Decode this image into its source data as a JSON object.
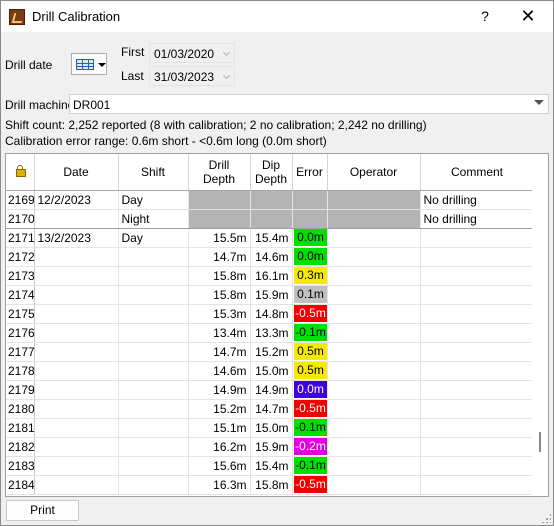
{
  "window": {
    "title": "Drill Calibration",
    "help": "?",
    "close": "✕"
  },
  "filters": {
    "drill_date_label": "Drill date",
    "first_label": "First",
    "first_value": "01/03/2020",
    "last_label": "Last",
    "last_value": "31/03/2023",
    "drill_machine_label": "Drill machine",
    "drill_machine_value": "DR001"
  },
  "summary": {
    "shift_count": "Shift count: 2,252 reported (8 with calibration; 2 no calibration; 2,242 no drilling)",
    "error_range": "Calibration error range: 0.6m short - <0.6m long (0.0m short)"
  },
  "table": {
    "columns": [
      "Date",
      "Shift",
      "Drill Depth",
      "Dip Depth",
      "Error",
      "Operator",
      "Comment"
    ],
    "header_drill_depth": [
      "Drill",
      "Depth"
    ],
    "header_dip_depth": [
      "Dip",
      "Depth"
    ],
    "rows": [
      {
        "idx": "2169",
        "date": "12/2/2023",
        "shift": "Day",
        "drill": "",
        "dip": "",
        "error": "",
        "operator": "",
        "comment": "No drilling",
        "grey": true
      },
      {
        "idx": "2170",
        "date": "",
        "shift": "Night",
        "drill": "",
        "dip": "",
        "error": "",
        "operator": "",
        "comment": "No drilling",
        "grey": true
      },
      {
        "idx": "2171",
        "date": "13/2/2023",
        "shift": "Day",
        "drill": "15.5m",
        "dip": "15.4m",
        "error": "0.0m",
        "operator": "",
        "comment": "",
        "color": "#00e000",
        "fg": "#000000"
      },
      {
        "idx": "2172",
        "date": "",
        "shift": "",
        "drill": "14.7m",
        "dip": "14.6m",
        "error": "0.0m",
        "operator": "",
        "comment": "",
        "color": "#00e000",
        "fg": "#000000"
      },
      {
        "idx": "2173",
        "date": "",
        "shift": "",
        "drill": "15.8m",
        "dip": "16.1m",
        "error": "0.3m",
        "operator": "",
        "comment": "",
        "color": "#f5ea00",
        "fg": "#000000"
      },
      {
        "idx": "2174",
        "date": "",
        "shift": "",
        "drill": "15.8m",
        "dip": "15.9m",
        "error": "0.1m",
        "operator": "",
        "comment": "",
        "color": "#c0c0c0",
        "fg": "#000000"
      },
      {
        "idx": "2175",
        "date": "",
        "shift": "",
        "drill": "15.3m",
        "dip": "14.8m",
        "error": "-0.5m",
        "operator": "",
        "comment": "",
        "color": "#f00000",
        "fg": "#ffffff"
      },
      {
        "idx": "2176",
        "date": "",
        "shift": "",
        "drill": "13.4m",
        "dip": "13.3m",
        "error": "-0.1m",
        "operator": "",
        "comment": "",
        "color": "#00e000",
        "fg": "#000000"
      },
      {
        "idx": "2177",
        "date": "",
        "shift": "",
        "drill": "14.7m",
        "dip": "15.2m",
        "error": "0.5m",
        "operator": "",
        "comment": "",
        "color": "#f5ea00",
        "fg": "#000000"
      },
      {
        "idx": "2178",
        "date": "",
        "shift": "",
        "drill": "14.6m",
        "dip": "15.0m",
        "error": "0.5m",
        "operator": "",
        "comment": "",
        "color": "#f5ea00",
        "fg": "#000000"
      },
      {
        "idx": "2179",
        "date": "",
        "shift": "",
        "drill": "14.9m",
        "dip": "14.9m",
        "error": "0.0m",
        "operator": "",
        "comment": "",
        "color": "#4000e0",
        "fg": "#ffffff"
      },
      {
        "idx": "2180",
        "date": "",
        "shift": "",
        "drill": "15.2m",
        "dip": "14.7m",
        "error": "-0.5m",
        "operator": "",
        "comment": "",
        "color": "#f00000",
        "fg": "#ffffff"
      },
      {
        "idx": "2181",
        "date": "",
        "shift": "",
        "drill": "15.1m",
        "dip": "15.0m",
        "error": "-0.1m",
        "operator": "",
        "comment": "",
        "color": "#00e000",
        "fg": "#000000"
      },
      {
        "idx": "2182",
        "date": "",
        "shift": "",
        "drill": "16.2m",
        "dip": "15.9m",
        "error": "-0.2m",
        "operator": "",
        "comment": "",
        "color": "#e000e0",
        "fg": "#ffffff"
      },
      {
        "idx": "2183",
        "date": "",
        "shift": "",
        "drill": "15.6m",
        "dip": "15.4m",
        "error": "-0.1m",
        "operator": "",
        "comment": "",
        "color": "#00e000",
        "fg": "#000000"
      },
      {
        "idx": "2184",
        "date": "",
        "shift": "",
        "drill": "16.3m",
        "dip": "15.8m",
        "error": "-0.5m",
        "operator": "",
        "comment": "",
        "color": "#f00000",
        "fg": "#ffffff"
      }
    ]
  },
  "footer": {
    "print_label": "Print"
  }
}
